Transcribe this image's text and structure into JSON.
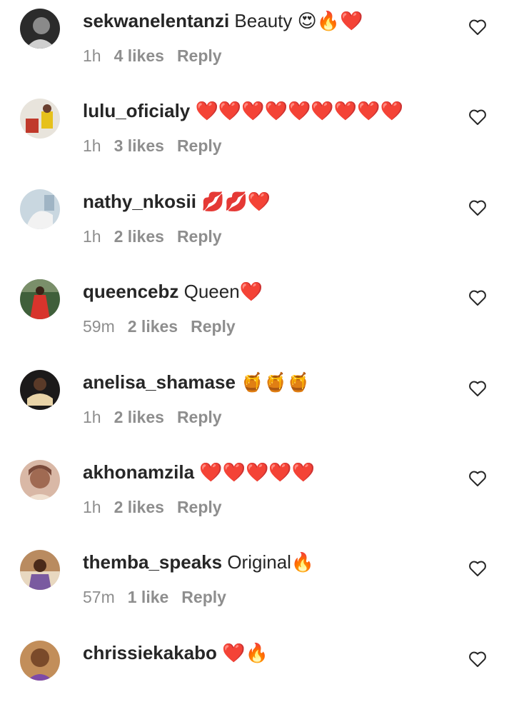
{
  "comments": [
    {
      "username": "sekwanelentanzi",
      "text": " Beauty 😍🔥❤️",
      "time": "1h",
      "likes": "4 likes",
      "reply": "Reply",
      "avatar": {
        "bg": "#2b2b2b",
        "fg": "#cfcfcf"
      }
    },
    {
      "username": "lulu_oficialy",
      "text": " ❤️❤️❤️❤️❤️❤️❤️❤️❤️",
      "time": "1h",
      "likes": "3 likes",
      "reply": "Reply",
      "avatar": {
        "bg": "#e8e4dc",
        "fg": "#e6c11c"
      }
    },
    {
      "username": "nathy_nkosii",
      "text": " 💋💋❤️",
      "time": "1h",
      "likes": "2 likes",
      "reply": "Reply",
      "avatar": {
        "bg": "#c9d7e0",
        "fg": "#f2f2f2"
      }
    },
    {
      "username": "queencebz",
      "text": " Queen❤️",
      "time": "59m",
      "likes": "2 likes",
      "reply": "Reply",
      "avatar": {
        "bg": "#3f5f3a",
        "fg": "#d8342c"
      }
    },
    {
      "username": "anelisa_shamase",
      "text": " 🍯🍯🍯",
      "time": "1h",
      "likes": "2 likes",
      "reply": "Reply",
      "avatar": {
        "bg": "#1c1a1a",
        "fg": "#e9d4a8"
      }
    },
    {
      "username": "akhonamzila",
      "text": " ❤️❤️❤️❤️❤️",
      "time": "1h",
      "likes": "2 likes",
      "reply": "Reply",
      "avatar": {
        "bg": "#d9b8a6",
        "fg": "#7a4a3a"
      }
    },
    {
      "username": "themba_speaks",
      "text": " Original🔥",
      "time": "57m",
      "likes": "1 like",
      "reply": "Reply",
      "avatar": {
        "bg": "#b98b60",
        "fg": "#7a5aa0"
      }
    },
    {
      "username": "chrissiekakabo",
      "text": " ❤️🔥",
      "time": "",
      "likes": "",
      "reply": "",
      "avatar": {
        "bg": "#c28e5a",
        "fg": "#7d4aa8"
      }
    }
  ]
}
